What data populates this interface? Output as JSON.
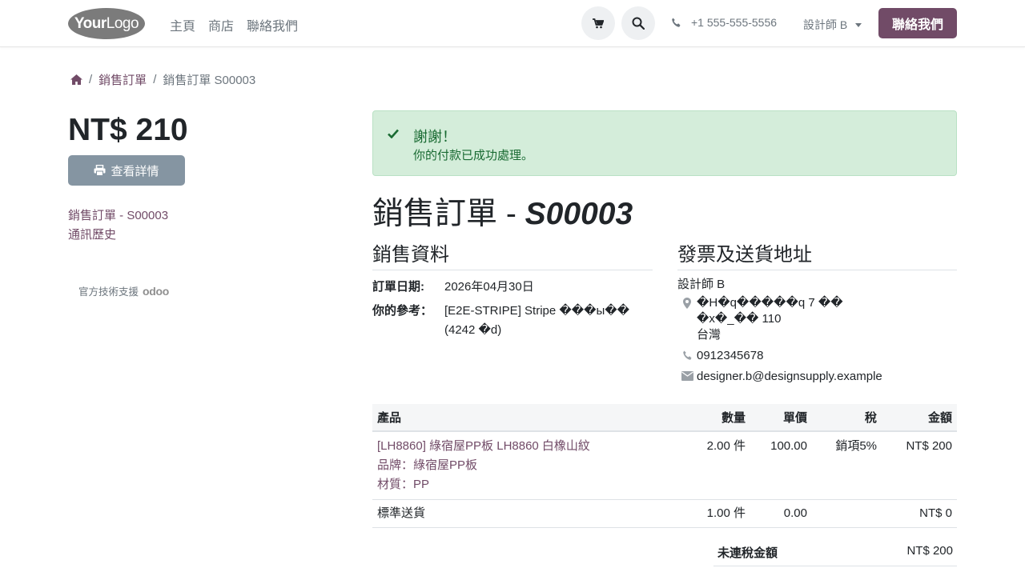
{
  "header": {
    "logo_part1": "Your",
    "logo_part2": "Logo",
    "nav": [
      "主頁",
      "商店",
      "聯絡我們"
    ],
    "phone": "+1 555-555-5556",
    "user": "設計師 B",
    "contact_button": "聯絡我們",
    "icons": [
      "cart-icon",
      "search-icon",
      "phone-icon",
      "home-icon"
    ]
  },
  "breadcrumb": {
    "home_icon": "home-icon",
    "item1": "銷售訂單",
    "item2": "銷售訂單 S00003"
  },
  "sidebar": {
    "amount": "NT$ 210",
    "view_button": "查看詳情",
    "links": [
      "銷售訂單 - S00003",
      "通訊歷史"
    ],
    "powered_by": "官方技術支援",
    "powered_brand": "odoo"
  },
  "alert": {
    "title": "謝謝！",
    "message": "你的付款已成功處理。"
  },
  "order": {
    "title_prefix": "銷售訂單 - ",
    "number": "S00003",
    "sales_info_heading": "銷售資料",
    "address_heading": "發票及送貨地址",
    "date_label": "訂單日期:",
    "date_value": "2026年04月30日",
    "ref_label": "你的參考：",
    "ref_value": "[E2E-STRIPE] Stripe ���ы�� (4242 �d)"
  },
  "address": {
    "name": "設計師 B",
    "street1": "�H�q�����q 7 ��",
    "street2": "�x�_�� 110",
    "country": "台灣",
    "phone": "0912345678",
    "email": "designer.b@designsupply.example"
  },
  "table": {
    "headers": [
      "產品",
      "數量",
      "單價",
      "稅",
      "金額"
    ],
    "rows": [
      {
        "product": "[LH8860] 綠宿屋PP板 LH8860 白橡山紋",
        "brand": "品牌：綠宿屋PP板",
        "material": "材質：PP",
        "qty": "2.00 件",
        "price": "100.00",
        "tax": "銷項5%",
        "amount": "NT$ 200"
      },
      {
        "product": "標準送貨",
        "qty": "1.00 件",
        "price": "0.00",
        "tax": "",
        "amount": "NT$ 0"
      }
    ]
  },
  "totals": {
    "untaxed_label": "未連稅金額",
    "untaxed_value": "NT$ 200"
  },
  "colors": {
    "brand": "#714b67",
    "alert_bg": "#d4edda",
    "alert_text": "#1a6b33",
    "secondary_btn": "#8595a2"
  }
}
